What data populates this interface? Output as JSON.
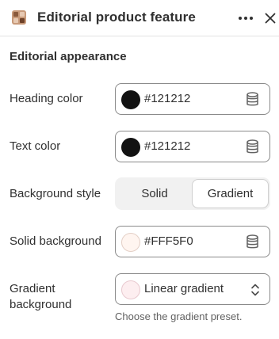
{
  "header": {
    "title": "Editorial product feature",
    "more_icon": "ellipsis-icon",
    "close_icon": "close-icon"
  },
  "section": {
    "title": "Editorial appearance"
  },
  "fields": {
    "heading_color": {
      "label": "Heading color",
      "value": "#121212",
      "swatch": "#121212"
    },
    "text_color": {
      "label": "Text color",
      "value": "#121212",
      "swatch": "#121212"
    },
    "background_style": {
      "label": "Background style",
      "options": [
        "Solid",
        "Gradient"
      ],
      "selected": "Gradient"
    },
    "solid_background": {
      "label": "Solid background",
      "value": "#FFF5F0",
      "swatch": "#FFF5F0"
    },
    "gradient_background": {
      "label_line1": "Gradient",
      "label_line2": "background",
      "value": "Linear gradient",
      "help": "Choose the gradient preset."
    }
  },
  "colors": {
    "text": "#303030",
    "border": "#8a8a8a",
    "segment_bg": "#f1f1f1"
  }
}
